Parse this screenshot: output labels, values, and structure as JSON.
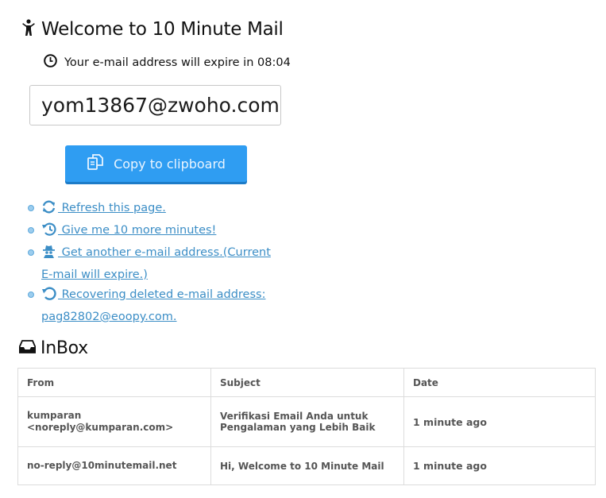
{
  "header": {
    "title": "Welcome to 10 Minute Mail",
    "expire_text": "Your e-mail address will expire in 08:04"
  },
  "email": {
    "address": "yom13867@zwoho.com"
  },
  "copy_button": {
    "label": "Copy to clipboard"
  },
  "actions": [
    {
      "icon": "refresh-icon",
      "label": " Refresh this page."
    },
    {
      "icon": "history-icon",
      "label": " Give me 10 more minutes!"
    },
    {
      "icon": "spy-icon",
      "label": " Get another e-mail address.(Current E-mail will expire.)"
    },
    {
      "icon": "undo-icon",
      "label": " Recovering deleted e-mail address: pag82802@eoopy.com."
    }
  ],
  "inbox": {
    "title": "InBox",
    "columns": [
      "From",
      "Subject",
      "Date"
    ],
    "rows": [
      {
        "from": "kumparan <noreply@kumparan.com>",
        "subject": "Verifikasi Email Anda untuk Pengalaman yang Lebih Baik",
        "date": "1 minute ago"
      },
      {
        "from": "no-reply@10minutemail.net",
        "subject": "Hi, Welcome to 10 Minute Mail",
        "date": "1 minute ago"
      }
    ]
  },
  "colors": {
    "button_bg": "#2f9df2",
    "link": "#3c8ec6"
  }
}
